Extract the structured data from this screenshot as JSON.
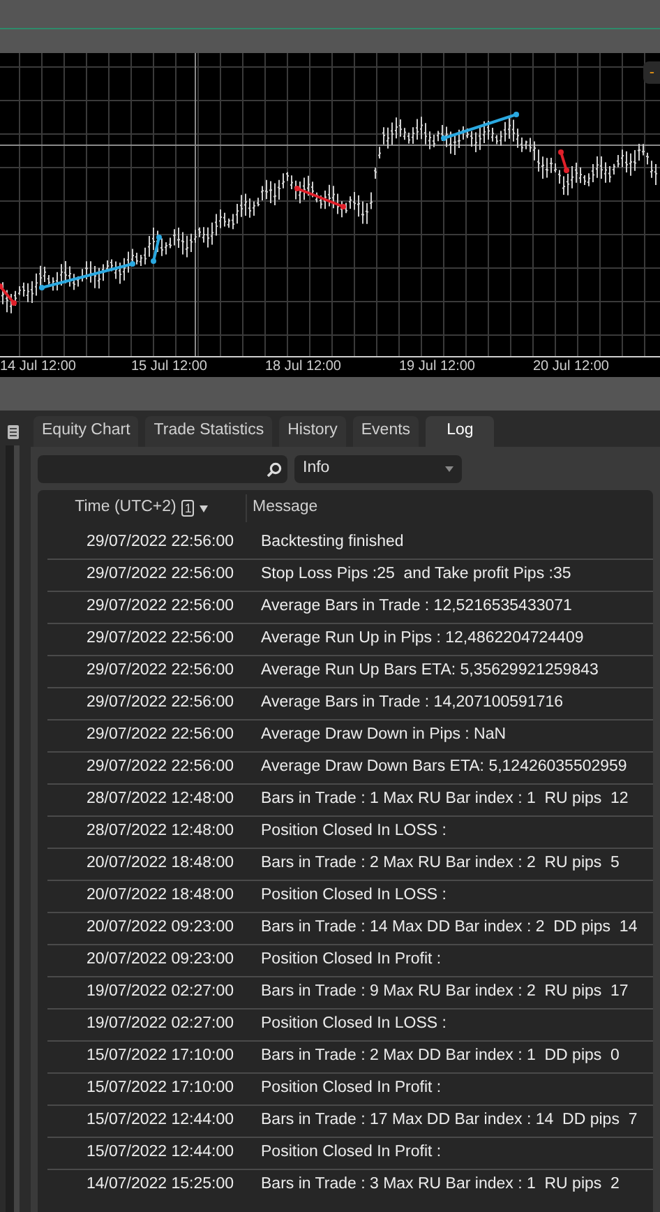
{
  "chart": {
    "price_tag": "-",
    "x_labels": [
      "14 Jul 12:00",
      "15 Jul 12:00",
      "18 Jul 12:00",
      "19 Jul 12:00",
      "20 Jul 12:00"
    ]
  },
  "tabs": [
    {
      "label": "Equity Chart",
      "selected": false
    },
    {
      "label": "Trade Statistics",
      "selected": false
    },
    {
      "label": "History",
      "selected": false
    },
    {
      "label": "Events",
      "selected": false
    },
    {
      "label": "Log",
      "selected": true
    }
  ],
  "filter": {
    "level": "Info"
  },
  "table": {
    "columns": [
      {
        "label": "Time (UTC+2)",
        "sort_order": "1"
      },
      {
        "label": "Message"
      }
    ],
    "rows": [
      {
        "time": "29/07/2022 22:56:00",
        "message": "Backtesting finished"
      },
      {
        "time": "29/07/2022 22:56:00",
        "message": "Stop Loss Pips :25  and Take profit Pips :35"
      },
      {
        "time": "29/07/2022 22:56:00",
        "message": "Average Bars in Trade : 12,5216535433071"
      },
      {
        "time": "29/07/2022 22:56:00",
        "message": "Average Run Up in Pips : 12,4862204724409"
      },
      {
        "time": "29/07/2022 22:56:00",
        "message": "Average Run Up Bars ETA: 5,35629921259843"
      },
      {
        "time": "29/07/2022 22:56:00",
        "message": "Average Bars in Trade : 14,207100591716"
      },
      {
        "time": "29/07/2022 22:56:00",
        "message": "Average Draw Down in Pips : NaN"
      },
      {
        "time": "29/07/2022 22:56:00",
        "message": "Average Draw Down Bars ETA: 5,12426035502959"
      },
      {
        "time": "28/07/2022 12:48:00",
        "message": "Bars in Trade : 1 Max RU Bar index : 1  RU pips  12"
      },
      {
        "time": "28/07/2022 12:48:00",
        "message": "Position Closed In LOSS :"
      },
      {
        "time": "20/07/2022 18:48:00",
        "message": "Bars in Trade : 2 Max RU Bar index : 2  RU pips  5"
      },
      {
        "time": "20/07/2022 18:48:00",
        "message": "Position Closed In LOSS :"
      },
      {
        "time": "20/07/2022 09:23:00",
        "message": "Bars in Trade : 14 Max DD Bar index : 2  DD pips  14"
      },
      {
        "time": "20/07/2022 09:23:00",
        "message": "Position Closed In Profit :"
      },
      {
        "time": "19/07/2022 02:27:00",
        "message": "Bars in Trade : 9 Max RU Bar index : 2  RU pips  17"
      },
      {
        "time": "19/07/2022 02:27:00",
        "message": "Position Closed In LOSS :"
      },
      {
        "time": "15/07/2022 17:10:00",
        "message": "Bars in Trade : 2 Max DD Bar index : 1  DD pips  0"
      },
      {
        "time": "15/07/2022 17:10:00",
        "message": "Position Closed In Profit :"
      },
      {
        "time": "15/07/2022 12:44:00",
        "message": "Bars in Trade : 17 Max DD Bar index : 14  DD pips  7"
      },
      {
        "time": "15/07/2022 12:44:00",
        "message": "Position Closed In Profit :"
      },
      {
        "time": "14/07/2022 15:25:00",
        "message": "Bars in Trade : 3 Max RU Bar index : 1  RU pips  2"
      }
    ]
  }
}
